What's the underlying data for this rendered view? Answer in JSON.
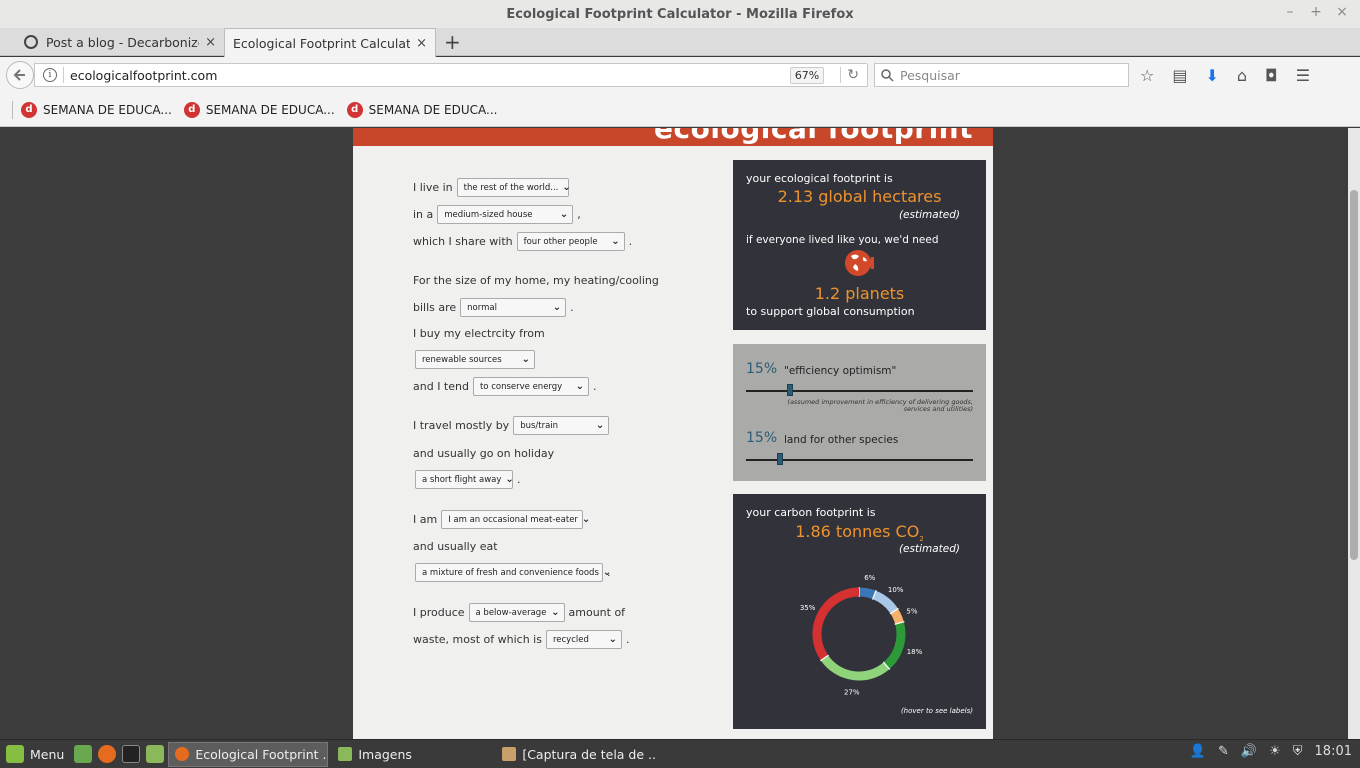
{
  "window": {
    "title": "Ecological Footprint Calculator - Mozilla Firefox",
    "min": "–",
    "max": "+",
    "close": "×"
  },
  "tabs": [
    {
      "label": "Post a blog - Decarbonize: D",
      "close": "×"
    },
    {
      "label": "Ecological Footprint Calculator",
      "close": "×"
    }
  ],
  "new_tab": "+",
  "nav": {
    "url": "ecologicalfootprint.com",
    "zoom": "67%",
    "search_placeholder": "Pesquisar"
  },
  "bookmarks": [
    {
      "label": "SEMANA DE EDUCA..."
    },
    {
      "label": "SEMANA DE EDUCA..."
    },
    {
      "label": "SEMANA DE EDUCA..."
    }
  ],
  "page": {
    "header_title": "ecological footprint",
    "form": {
      "live_in": "I live in",
      "live_in_value": "the rest of the world...",
      "in_a": "in a",
      "house_value": "medium-sized house",
      "comma": ",",
      "share_with": "which I share with",
      "share_value": "four other people",
      "period": ".",
      "heating_q": "For the size of my home, my heating/cooling",
      "bills_are": "bills are",
      "bills_value": "normal",
      "electricity_q": "I buy my electrcity from",
      "electricity_value": "renewable sources",
      "tend": "and I tend",
      "tend_value": "to conserve energy",
      "travel": "I travel mostly by",
      "travel_value": "bus/train",
      "holiday": "and usually go on holiday",
      "holiday_value": "a short flight away",
      "i_am": "I am",
      "diet_value": "I am an occasional meat-eater",
      "eat": "and usually eat",
      "eat_value": "a mixture of fresh and convenience foods",
      "produce": "I produce",
      "produce_value": "a below-average",
      "amount_of": "amount of",
      "waste": "waste, most of which is",
      "waste_value": "recycled"
    },
    "result": {
      "eco_label": "your ecological footprint is",
      "hectares": "2.13 global hectares",
      "estimated": "(estimated)",
      "everyone": "if everyone lived like you, we'd need",
      "planets": "1.2 planets",
      "support": "to support global consumption"
    },
    "sliders": {
      "efficiency_pct": "15%",
      "efficiency_label": "\"efficiency optimism\"",
      "efficiency_value": 0.15,
      "efficiency_note": "(assumed improvement in efficiency of delivering goods, services and utilities)",
      "species_pct": "15%",
      "species_label": "land for other species",
      "species_value": 0.15
    },
    "carbon": {
      "label": "your carbon footprint is",
      "value": "1.86 tonnes CO",
      "sub": "2",
      "estimated": "(estimated)",
      "hover": "(hover to see labels)"
    }
  },
  "chart_data": {
    "type": "pie",
    "values": [
      6,
      10,
      5,
      18,
      27,
      35
    ],
    "labels": [
      "6%",
      "10%",
      "5%",
      "18%",
      "27%",
      "35%"
    ],
    "colors": [
      "#3a78b5",
      "#a9c8e8",
      "#f5b26b",
      "#2d9a3a",
      "#8fd47a",
      "#d63131"
    ]
  },
  "taskbar": {
    "menu": "Menu",
    "windows": [
      {
        "label": "Ecological Footprint ..."
      },
      {
        "label": "Imagens"
      },
      {
        "label": "[Captura de tela de ..."
      }
    ],
    "clock": "18:01"
  }
}
